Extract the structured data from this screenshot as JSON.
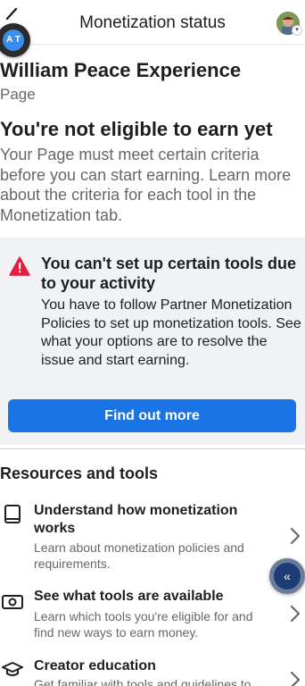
{
  "header": {
    "title": "Monetization status",
    "translate_badge": "A T"
  },
  "page": {
    "name": "William Peace Experience",
    "type": "Page"
  },
  "eligibility": {
    "title": "You're not eligible to earn yet",
    "description": "Your Page must meet certain criteria before you can start earning. Learn more about the criteria for each tool in the Monetization tab."
  },
  "alert": {
    "title": "You can't set up certain tools due to your activity",
    "description": "You have to follow Partner Monetization Policies to set up monetization tools. See what your options are to resolve the issue and start earning.",
    "button_label": "Find out more",
    "icon": "warning-icon"
  },
  "resources": {
    "title": "Resources and tools",
    "items": [
      {
        "title": "Understand how monetization works",
        "description": "Learn about monetization policies and requirements.",
        "icon": "book-icon"
      },
      {
        "title": "See what tools are available",
        "description": "Learn which tools you're eligible for and find new ways to earn money.",
        "icon": "money-icon"
      },
      {
        "title": "Creator education",
        "description": "Get familiar with tools and guidelines to",
        "icon": "graduation-cap-icon"
      }
    ]
  },
  "floating_button": {
    "icon": "double-chevron-left-icon",
    "glyph": "«"
  },
  "colors": {
    "accent": "#1b74e4",
    "warning": "#e41e3f",
    "card_bg": "#f0f2f5",
    "secondary_text": "#65676b"
  }
}
